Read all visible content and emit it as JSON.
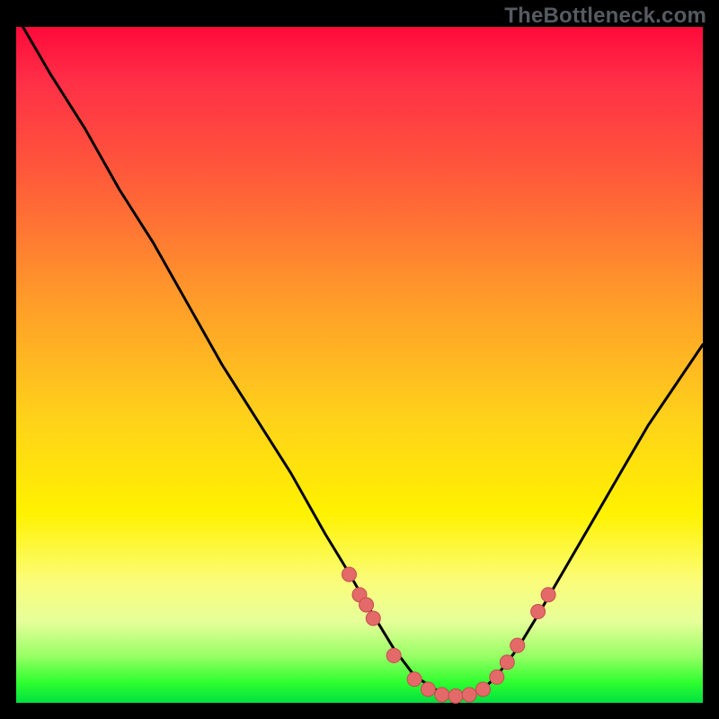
{
  "watermark": "TheBottleneck.com",
  "colors": {
    "curve": "#000000",
    "dots": "#e46a6a",
    "dot_stroke": "#c44d4d"
  },
  "chart_data": {
    "type": "line",
    "title": "",
    "xlabel": "",
    "ylabel": "",
    "xlim": [
      0,
      100
    ],
    "ylim": [
      0,
      100
    ],
    "series": [
      {
        "name": "bottleneck-curve",
        "x": [
          1,
          5,
          10,
          15,
          20,
          25,
          30,
          35,
          40,
          45,
          48,
          52,
          55,
          58,
          61,
          63,
          65,
          68,
          70,
          73,
          76,
          80,
          84,
          88,
          92,
          96,
          100
        ],
        "y": [
          100,
          93,
          85,
          76,
          68,
          59,
          50,
          42,
          34,
          25,
          20,
          13,
          8,
          4,
          2,
          1,
          1,
          2,
          4,
          8,
          13,
          20,
          27,
          34,
          41,
          47,
          53
        ]
      }
    ],
    "markers": {
      "name": "highlight-dots",
      "x": [
        48.5,
        50,
        51,
        52,
        55,
        58,
        60,
        62,
        64,
        66,
        68,
        70,
        71.5,
        73,
        76,
        77.5
      ],
      "y": [
        19,
        16,
        14.5,
        12.5,
        7,
        3.5,
        2,
        1.2,
        1,
        1.2,
        2,
        3.8,
        6,
        8.5,
        13.5,
        16
      ]
    }
  }
}
